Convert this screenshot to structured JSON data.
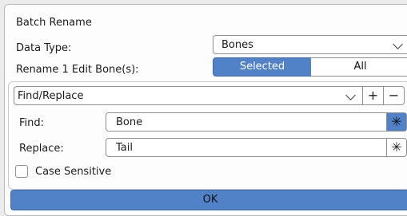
{
  "dialog": {
    "title": "Batch Rename",
    "data_type_label": "Data Type:",
    "data_type_value": "Bones",
    "rename_label": "Rename 1 Edit Bone(s):",
    "mode_options": [
      "Selected",
      "All"
    ],
    "mode_selected": "Selected",
    "operation": "Find/Replace",
    "add_symbol": "+",
    "remove_symbol": "−",
    "find_label": "Find:",
    "find_value": "Bone",
    "replace_label": "Replace:",
    "replace_value": "Tail",
    "regex_symbol": "✳",
    "find_regex_enabled": true,
    "replace_regex_enabled": false,
    "case_sensitive_label": "Case Sensitive",
    "case_sensitive_checked": false,
    "ok_label": "OK"
  },
  "colors": {
    "accent": "#5182c7",
    "panel_bg": "#fdfdfd",
    "border": "#8f8f8f"
  }
}
